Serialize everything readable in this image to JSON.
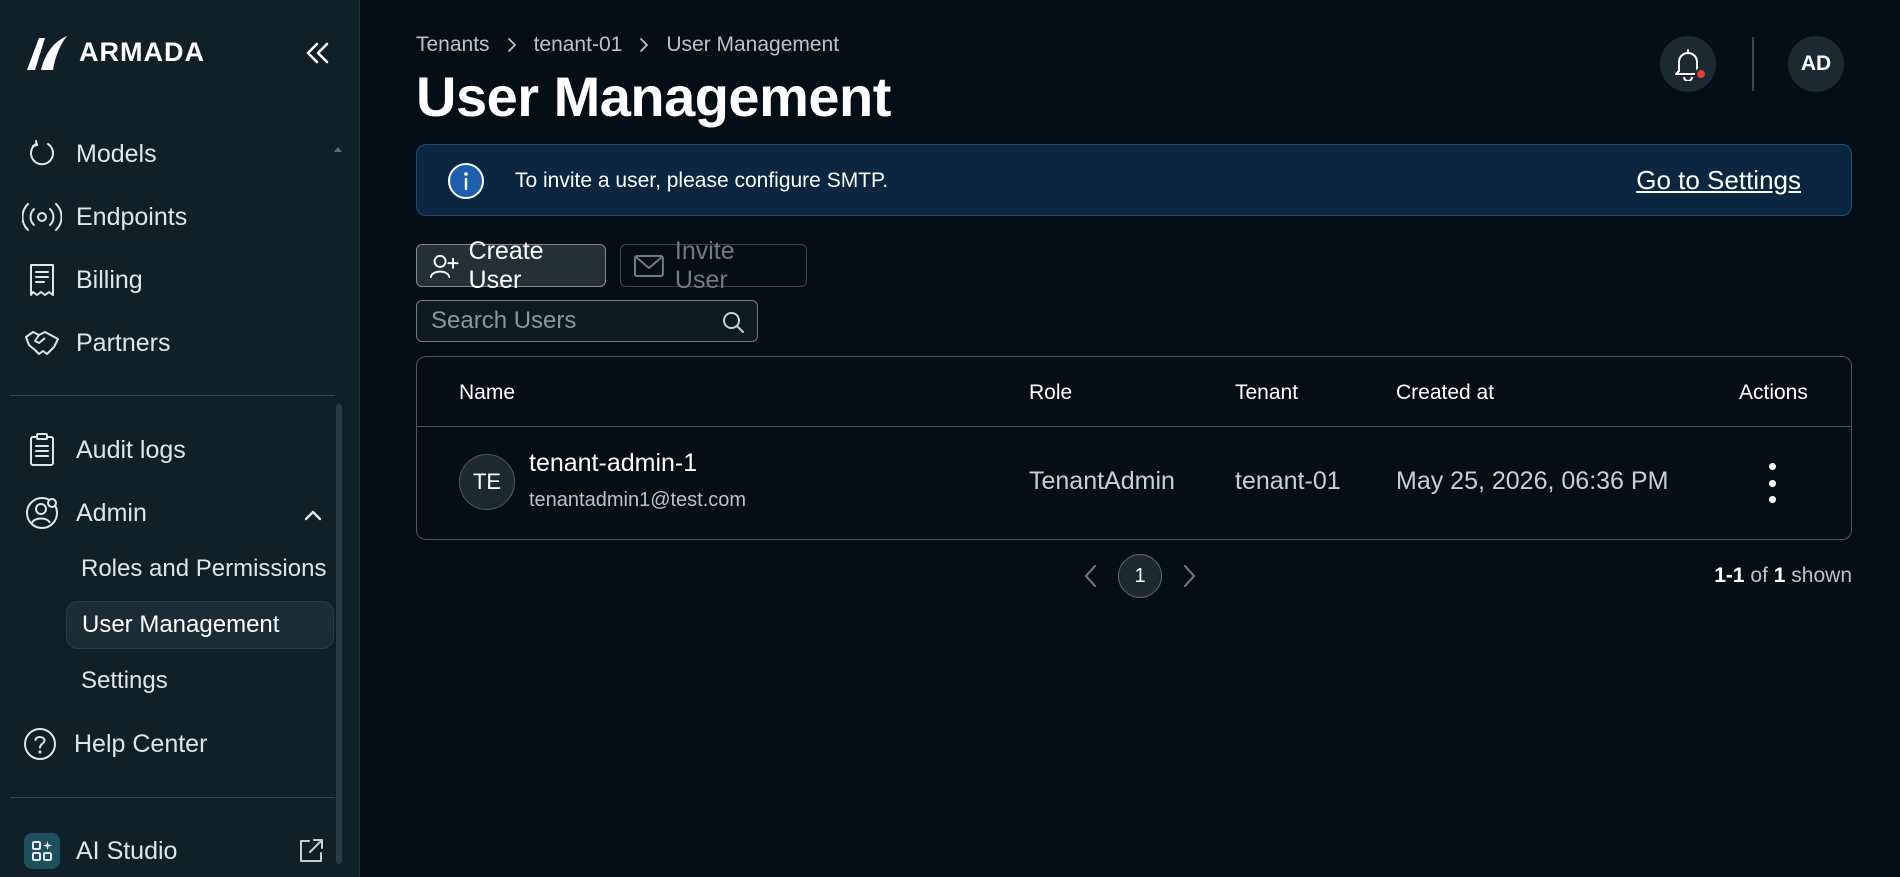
{
  "brand": {
    "name": "ARMADA"
  },
  "sidebar": {
    "items": [
      {
        "label": "Models",
        "icon": "models-icon"
      },
      {
        "label": "Endpoints",
        "icon": "endpoints-icon"
      },
      {
        "label": "Billing",
        "icon": "billing-icon"
      },
      {
        "label": "Partners",
        "icon": "partners-icon"
      },
      {
        "label": "Audit logs",
        "icon": "audit-logs-icon"
      },
      {
        "label": "Admin",
        "icon": "admin-icon"
      }
    ],
    "admin_sub": [
      {
        "label": "Roles and Permissions"
      },
      {
        "label": "User Management",
        "active": true
      },
      {
        "label": "Settings"
      }
    ],
    "help": {
      "label": "Help Center"
    },
    "studio": {
      "label": "AI Studio"
    }
  },
  "breadcrumb": [
    "Tenants",
    "tenant-01",
    "User Management"
  ],
  "page": {
    "title": "User Management"
  },
  "header": {
    "avatar_initials": "AD",
    "notification_dot_color": "#e33b3b"
  },
  "banner": {
    "text": "To invite a user, please configure SMTP.",
    "link": "Go to Settings"
  },
  "toolbar": {
    "create_label": "Create User",
    "invite_label": "Invite User"
  },
  "search": {
    "placeholder": "Search Users"
  },
  "table": {
    "columns": [
      "Name",
      "Role",
      "Tenant",
      "Created at",
      "Actions"
    ],
    "rows": [
      {
        "initials": "TE",
        "name": "tenant-admin-1",
        "email": "tenantadmin1@test.com",
        "role": "TenantAdmin",
        "tenant": "tenant-01",
        "created_at": "May 25, 2026, 06:36 PM"
      }
    ]
  },
  "pagination": {
    "current_page": "1",
    "range": "1-1",
    "of_word": "of",
    "total": "1",
    "shown_word": "shown"
  },
  "colors": {
    "background": "#030f15",
    "sidebar": "#0f2029",
    "banner_bg": "#0b2640",
    "banner_border": "#1f4c78",
    "info_accent": "#3d7fd6"
  }
}
